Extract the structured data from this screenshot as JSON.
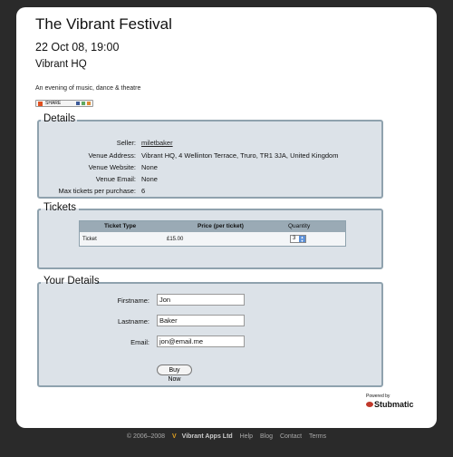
{
  "event": {
    "title": "The Vibrant Festival",
    "datetime": "22 Oct 08, 19:00",
    "venue": "Vibrant HQ",
    "description": "An evening of music, dance & theatre",
    "share_label": "SHARE"
  },
  "details": {
    "legend": "Details",
    "rows": [
      {
        "label": "Seller:",
        "value": "miletbaker"
      },
      {
        "label": "Venue Address:",
        "value": "Vibrant HQ, 4 Wellinton Terrace, Truro, TR1 3JA, United Kingdom"
      },
      {
        "label": "Venue Website:",
        "value": "None"
      },
      {
        "label": "Venue Email:",
        "value": "None"
      },
      {
        "label": "Max tickets per purchase:",
        "value": "6"
      }
    ]
  },
  "tickets": {
    "legend": "Tickets",
    "headers": [
      "Ticket Type",
      "Price (per ticket)",
      "Quantity"
    ],
    "rows": [
      {
        "type": "Ticket",
        "price": "£15.00",
        "quantity": "3"
      }
    ]
  },
  "your_details": {
    "legend": "Your Details",
    "firstname_label": "Firstname:",
    "firstname_value": "Jon",
    "lastname_label": "Lastname:",
    "lastname_value": "Baker",
    "email_label": "Email:",
    "email_value": "jon@email.me",
    "buy_label": "Buy Now"
  },
  "branding": {
    "powered_by": "Powered by",
    "name": "Stubmatic"
  },
  "footer": {
    "copyright": "© 2006–2008",
    "company": "Vibrant Apps Ltd",
    "links": [
      "Help",
      "Blog",
      "Contact",
      "Terms"
    ]
  }
}
